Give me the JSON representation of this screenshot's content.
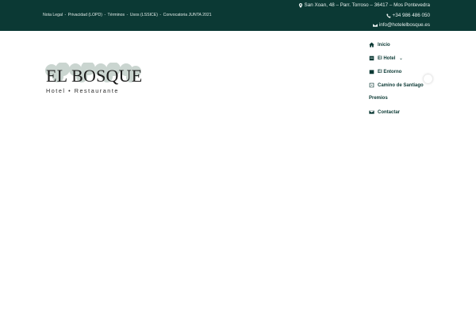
{
  "topbar": {
    "legal_links": [
      {
        "label": "Nota Legal"
      },
      {
        "label": "Privacidad (LOPD)"
      },
      {
        "label": "Términos"
      },
      {
        "label": "Usos (LSSICE)"
      },
      {
        "label": "Convocatoria JUNTA 2021"
      }
    ],
    "separator": "-",
    "address": "San Xoan, 48 – Parr. Torroso – 36417 – Mos Pontevedra",
    "phone": "+34 986 486 050",
    "email": "info@hotelelbosque.es",
    "icons": {
      "address": "map-marker-icon",
      "phone": "phone-icon",
      "email": "envelope-icon"
    }
  },
  "logo": {
    "title": "EL BOSQUE",
    "subtitle_left": "Hotel",
    "subtitle_right": "Restaurante"
  },
  "nav": {
    "items": [
      {
        "label": "Inicio",
        "icon": "home-icon"
      },
      {
        "label": "El Hotel",
        "icon": "hotel-icon",
        "has_dropdown": true
      },
      {
        "label": "El Entorno",
        "icon": "calendar-icon"
      },
      {
        "label": "Camino de Santiago",
        "icon": "map-icon"
      },
      {
        "label": "Premios",
        "icon": ""
      },
      {
        "label": "Contactar",
        "icon": "envelope-icon"
      }
    ],
    "dropdown_glyph": "⌄"
  },
  "colors": {
    "brand_dark": "#0b3934",
    "background": "#ffffff"
  }
}
